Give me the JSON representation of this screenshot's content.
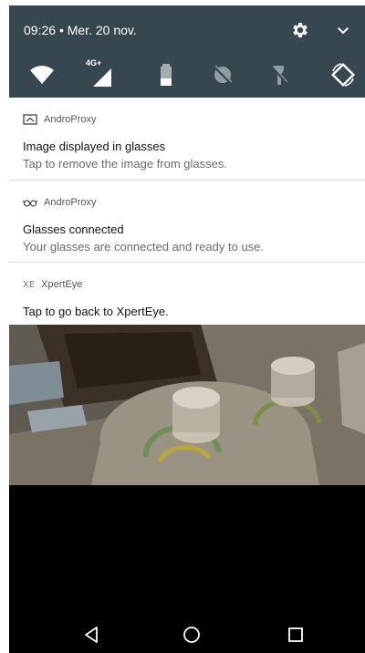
{
  "status": {
    "time": "09:26",
    "separator": "•",
    "date": "Mer. 20 nov.",
    "network_label": "4G+",
    "icons": [
      "wifi-icon",
      "cellular-icon",
      "battery-icon",
      "location-off-icon",
      "flashlight-off-icon",
      "auto-rotate-icon",
      "settings-gear-icon",
      "expand-chevron-icon"
    ]
  },
  "notifications": [
    {
      "app": "AndroProxy",
      "icon": "image-glasses-icon",
      "title": "Image displayed in glasses",
      "text": "Tap to remove the image from glasses."
    },
    {
      "app": "AndroProxy",
      "icon": "glasses-icon",
      "title": "Glasses connected",
      "text": "Your glasses are connected and ready to use."
    },
    {
      "app": "XpertEye",
      "badge": "XE",
      "title": "Tap to go back to XpertEye."
    }
  ],
  "navbar": {
    "icons": [
      "back-icon",
      "home-icon",
      "recents-icon"
    ]
  },
  "colors": {
    "quick_settings_bg": "#37474f",
    "notification_bg": "#ffffff",
    "background": "#000000"
  }
}
